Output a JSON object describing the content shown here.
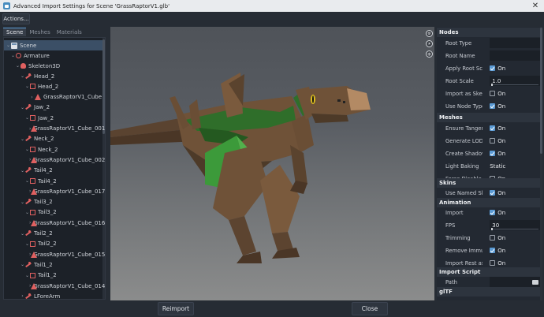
{
  "window": {
    "title": "Advanced Import Settings for Scene 'GrassRaptorV1.glb'"
  },
  "toolbar": {
    "actions_label": "Actions..."
  },
  "tabs": [
    {
      "label": "Scene"
    },
    {
      "label": "Meshes"
    },
    {
      "label": "Materials"
    }
  ],
  "tree": {
    "scene": "Scene",
    "armature": "Armature",
    "skeleton": "Skeleton3D",
    "nodes": [
      {
        "label": "Head_2"
      },
      {
        "label": "Head_2"
      },
      {
        "label": "GrassRaptorV1_Cube"
      },
      {
        "label": "Jaw_2"
      },
      {
        "label": "Jaw_2"
      },
      {
        "label": "GrassRaptorV1_Cube_001"
      },
      {
        "label": "Neck_2"
      },
      {
        "label": "Neck_2"
      },
      {
        "label": "GrassRaptorV1_Cube_002"
      },
      {
        "label": "Tail4_2"
      },
      {
        "label": "Tail4_2"
      },
      {
        "label": "GrassRaptorV1_Cube_017"
      },
      {
        "label": "Tail3_2"
      },
      {
        "label": "Tail3_2"
      },
      {
        "label": "GrassRaptorV1_Cube_016"
      },
      {
        "label": "Tail2_2"
      },
      {
        "label": "Tail2_2"
      },
      {
        "label": "GrassRaptorV1_Cube_015"
      },
      {
        "label": "Tail1_2"
      },
      {
        "label": "Tail1_2"
      },
      {
        "label": "GrassRaptorV1_Cube_014"
      },
      {
        "label": "LForeArm"
      }
    ]
  },
  "viewport": {
    "buttons": [
      "gizmo-icon",
      "sun-icon",
      "environment-icon"
    ]
  },
  "inspector": {
    "nodes_header": "Nodes",
    "root_type": "Root Type",
    "root_name": "Root Name",
    "apply_root_scale": "Apply Root Scale",
    "root_scale": "Root Scale",
    "root_scale_value": "1.0",
    "import_as_skeleton": "Import as Skeleto",
    "use_node_type_suffixes": "Use Node Type Su",
    "meshes_header": "Meshes",
    "ensure_tangents": "Ensure Tangents",
    "generate_lods": "Generate LODs",
    "create_shadow_meshes": "Create Shadow M",
    "light_baking": "Light Baking",
    "light_baking_value": "Static",
    "force_disable_compression": "Force Disable Co",
    "skins_header": "Skins",
    "use_named_skins": "Use Named Skins",
    "animation_header": "Animation",
    "import": "Import",
    "fps": "FPS",
    "fps_value": "30",
    "trimming": "Trimming",
    "remove_immutable": "Remove Immutabl",
    "import_rest_as_reset": "Import Rest as Re",
    "import_script_header": "Import Script",
    "path": "Path",
    "gltf_header": "glTF",
    "on": "On"
  },
  "footer": {
    "reimport_label": "Reimport",
    "close_label": "Close"
  }
}
